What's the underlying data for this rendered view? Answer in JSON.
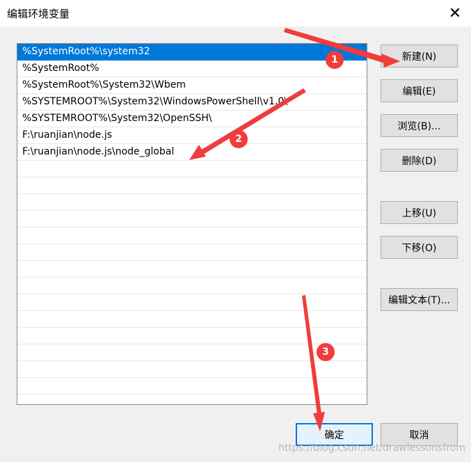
{
  "window": {
    "title": "编辑环境变量",
    "close_icon": "close-icon"
  },
  "path_list": [
    {
      "text": "%SystemRoot%\\system32",
      "selected": true
    },
    {
      "text": "%SystemRoot%",
      "selected": false
    },
    {
      "text": "%SystemRoot%\\System32\\Wbem",
      "selected": false
    },
    {
      "text": "%SYSTEMROOT%\\System32\\WindowsPowerShell\\v1.0\\",
      "selected": false
    },
    {
      "text": "%SYSTEMROOT%\\System32\\OpenSSH\\",
      "selected": false
    },
    {
      "text": "F:\\ruanjian\\node.js",
      "selected": false
    },
    {
      "text": "F:\\ruanjian\\node.js\\node_global",
      "selected": false
    }
  ],
  "buttons": {
    "new": "新建(N)",
    "edit": "编辑(E)",
    "browse": "浏览(B)...",
    "delete": "删除(D)",
    "move_up": "上移(U)",
    "move_down": "下移(O)",
    "edit_text": "编辑文本(T)...",
    "ok": "确定",
    "cancel": "取消"
  },
  "annotations": {
    "badges": [
      "1",
      "2",
      "3"
    ],
    "color": "#f03c3c"
  },
  "watermark": "https://blog.csdn.net/drawlessonsfrom"
}
